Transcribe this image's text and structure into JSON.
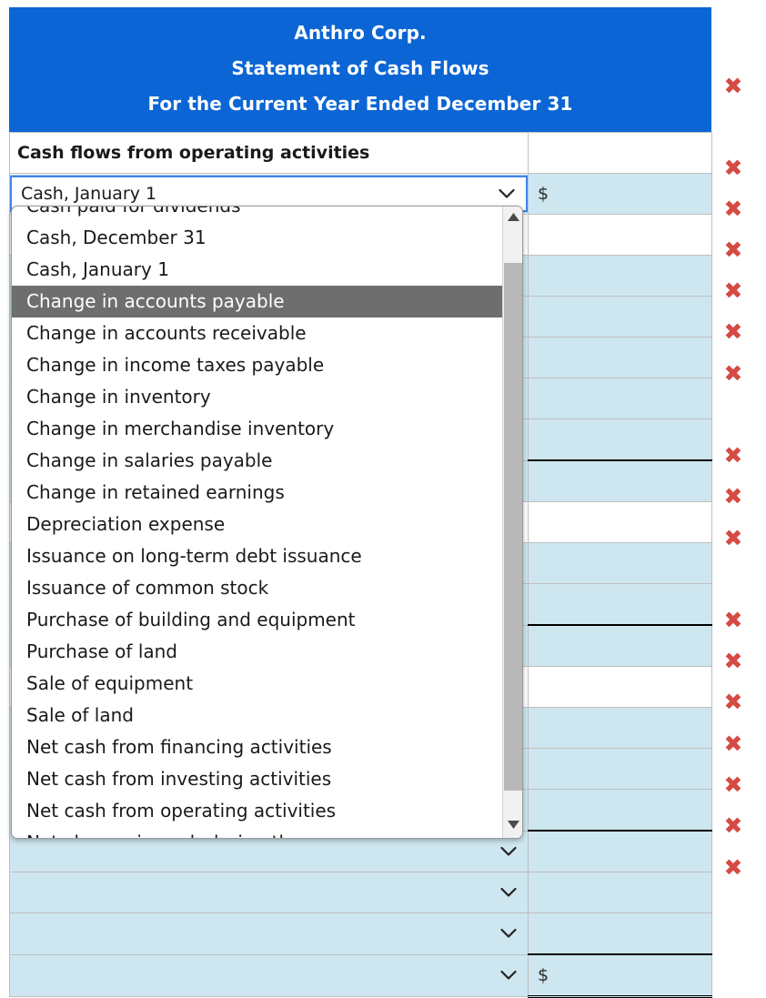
{
  "header": {
    "company": "Anthro Corp.",
    "statement": "Statement of Cash Flows",
    "period": "For the Current Year Ended December 31",
    "bg_color": "#0b65d4",
    "text_color": "#ffffff"
  },
  "section": {
    "heading": "Cash flows from operating activities"
  },
  "colors": {
    "input_cell": "#cee6ef",
    "blank_cell": "#ffffff",
    "delete_icon": "#d64a44",
    "dropdown_highlight": "#6e6e6e",
    "focus_border": "#4285e4"
  },
  "active_select": {
    "value": "Cash, January 1",
    "state": "open",
    "highlighted_option": "Change in accounts payable"
  },
  "dropdown": {
    "options": [
      "Cash paid for dividends",
      "Cash, December 31",
      "Cash, January 1",
      "Change in accounts payable",
      "Change in accounts receivable",
      "Change in income taxes payable",
      "Change in inventory",
      "Change in merchandise inventory",
      "Change in salaries payable",
      "Change in retained earnings",
      "Depreciation expense",
      "Issuance on long-term debt issuance",
      "Issuance of common stock",
      "Purchase of building and equipment",
      "Purchase of land",
      "Sale of equipment",
      "Sale of land",
      "Net cash from financing activities",
      "Net cash from investing activities",
      "Net cash from operating activities",
      "Net change in cash during the year"
    ],
    "selected_index": 3,
    "scrollbar": {
      "up_arrow": "scroll-up-arrow",
      "down_arrow": "scroll-down-arrow"
    }
  },
  "rows": [
    {
      "kind": "section-heading",
      "label": "Cash flows from operating activities",
      "value": "",
      "value_style": "white",
      "delete": false
    },
    {
      "kind": "select-open",
      "label": "Cash, January 1",
      "value": "$",
      "value_style": "blue",
      "delete": true
    },
    {
      "kind": "select",
      "label": "",
      "value": "",
      "value_style": "white",
      "delete": false
    },
    {
      "kind": "select",
      "label": "",
      "value": "",
      "value_style": "blue",
      "delete": true
    },
    {
      "kind": "select",
      "label": "",
      "value": "",
      "value_style": "blue",
      "delete": true
    },
    {
      "kind": "select",
      "label": "",
      "value": "",
      "value_style": "blue",
      "delete": true
    },
    {
      "kind": "select",
      "label": "",
      "value": "",
      "value_style": "blue",
      "delete": true
    },
    {
      "kind": "select",
      "label": "",
      "value": "",
      "value_style": "blue",
      "delete": true
    },
    {
      "kind": "select",
      "label": "",
      "value": "",
      "value_style": "blue",
      "rule": "top",
      "delete": true
    },
    {
      "kind": "select",
      "label": "",
      "value": "",
      "value_style": "white",
      "delete": false
    },
    {
      "kind": "select",
      "label": "",
      "value": "",
      "value_style": "blue",
      "delete": true
    },
    {
      "kind": "select",
      "label": "",
      "value": "",
      "value_style": "blue",
      "delete": true
    },
    {
      "kind": "select",
      "label": "",
      "value": "",
      "value_style": "blue",
      "rule": "top",
      "delete": true
    },
    {
      "kind": "select",
      "label": "",
      "value": "",
      "value_style": "white",
      "delete": false
    },
    {
      "kind": "select",
      "label": "",
      "value": "",
      "value_style": "blue",
      "delete": true
    },
    {
      "kind": "select",
      "label": "",
      "value": "",
      "value_style": "blue",
      "delete": true
    },
    {
      "kind": "select",
      "label": "",
      "value": "",
      "value_style": "blue",
      "delete": true
    },
    {
      "kind": "select",
      "label": "",
      "value": "",
      "value_style": "blue",
      "rule": "top",
      "delete": true
    },
    {
      "kind": "select",
      "label": "",
      "value": "",
      "value_style": "blue",
      "delete": true
    },
    {
      "kind": "select",
      "label": "",
      "value": "",
      "value_style": "blue",
      "delete": true
    },
    {
      "kind": "select",
      "label": "",
      "value": "$",
      "value_style": "blue",
      "rule": "top",
      "rule_bottom": "double",
      "delete": true
    }
  ],
  "icons": {
    "chevron_down": "chevron-down-icon",
    "delete": "delete-row-icon",
    "delete_glyph": "✖"
  }
}
